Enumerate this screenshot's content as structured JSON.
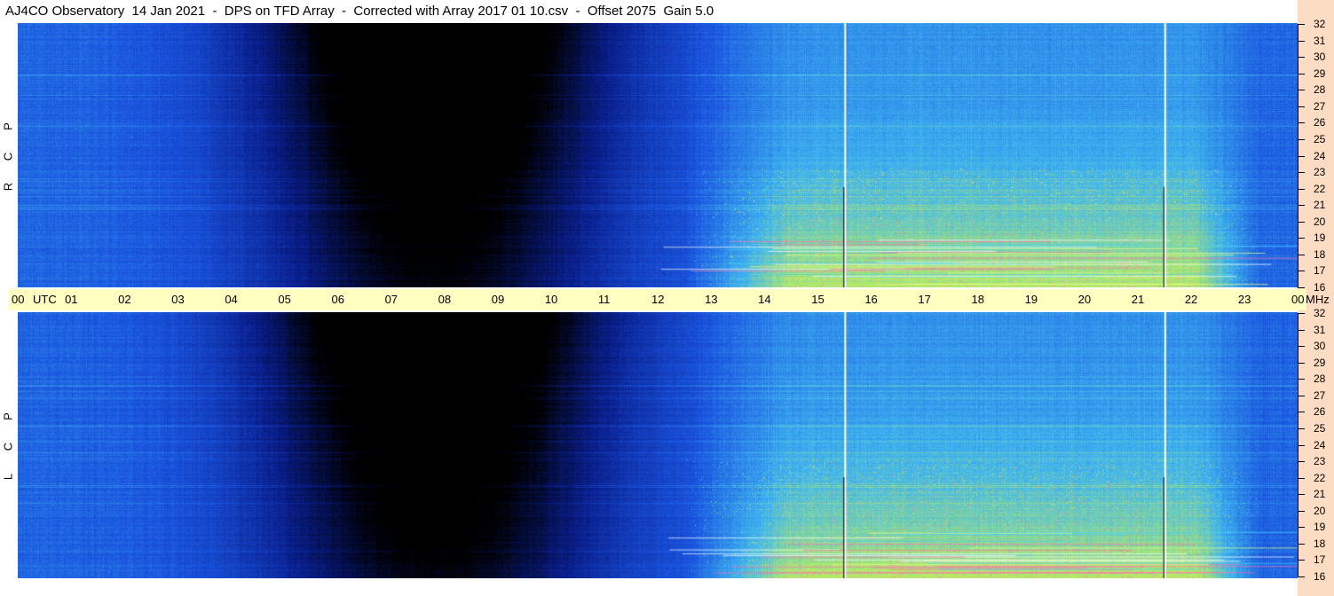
{
  "title": "AJ4CO Observatory  14 Jan 2021  -  DPS on TFD Array  -  Corrected with Array 2017 01 10.csv  -  Offset 2075  Gain 5.0",
  "polarization_labels": {
    "top": [
      "R",
      "C",
      "P"
    ],
    "bottom": [
      "L",
      "C",
      "P"
    ]
  },
  "time_axis": {
    "unit_label": "UTC",
    "ticks": [
      "00",
      "01",
      "02",
      "03",
      "04",
      "05",
      "06",
      "07",
      "08",
      "09",
      "10",
      "11",
      "12",
      "13",
      "14",
      "15",
      "16",
      "17",
      "18",
      "19",
      "20",
      "21",
      "22",
      "23",
      "00"
    ],
    "end_unit": "MHz"
  },
  "freq_axis": {
    "ticks": [
      "32",
      "31",
      "30",
      "29",
      "28",
      "27",
      "26",
      "25",
      "24",
      "23",
      "22",
      "21",
      "20",
      "19",
      "18",
      "17",
      "16"
    ]
  },
  "colors": {
    "background": "#ffffff",
    "time_band": "#ffffc2",
    "right_strip": "#fddcc4"
  },
  "chart_data": {
    "type": "heatmap",
    "title": "AJ4CO Observatory  14 Jan 2021  -  DPS on TFD Array  -  Corrected with Array 2017 01 10.csv  -  Offset 2075  Gain 5.0",
    "xlabel": "UTC",
    "ylabel": "MHz",
    "xlim": [
      0,
      24
    ],
    "ylim": [
      16,
      32
    ],
    "panels": [
      "RCP",
      "LCP"
    ],
    "colormap": [
      "#000000",
      "#0a1f8c",
      "#1a55e0",
      "#3fb4f0",
      "#b8f060",
      "#ff6fb0",
      "#ffffff"
    ],
    "vertical_markers_utc": [
      15.5,
      21.5
    ]
  }
}
